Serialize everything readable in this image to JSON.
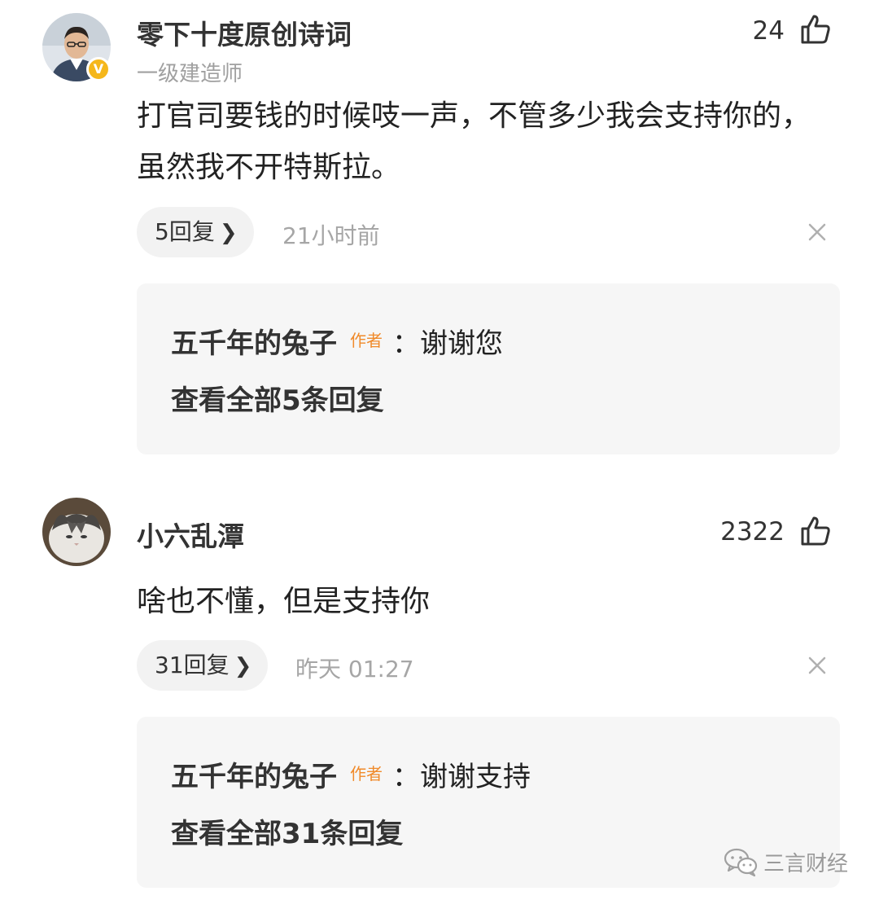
{
  "comments": [
    {
      "username": "零下十度原创诗词",
      "user_title": "一级建造师",
      "verified_badge": "V",
      "likes": "24",
      "content": "打官司要钱的时候吱一声，不管多少我会支持你的，虽然我不开特斯拉。",
      "reply_pill": "5回复",
      "timestamp": "21小时前",
      "reply_preview": {
        "author": "五千年的兔子",
        "author_tag": "作者",
        "text": "：谢谢您",
        "view_all": "查看全部5条回复"
      }
    },
    {
      "username": "小六乱潭",
      "likes": "2322",
      "content": "啥也不懂，但是支持你",
      "reply_pill": "31回复",
      "timestamp": "昨天 01:27",
      "reply_preview": {
        "author": "五千年的兔子",
        "author_tag": "作者",
        "text": "：谢谢支持",
        "view_all": "查看全部31条回复"
      }
    }
  ],
  "watermark": "三言财经",
  "colors": {
    "author_tag": "#f08a2a",
    "verified_badge": "#f5b71b",
    "muted": "#a6a6a6",
    "reply_bg": "#f6f6f6"
  },
  "icons": [
    "thumbs-up-icon",
    "chevron-right-icon",
    "close-icon",
    "wechat-icon"
  ]
}
